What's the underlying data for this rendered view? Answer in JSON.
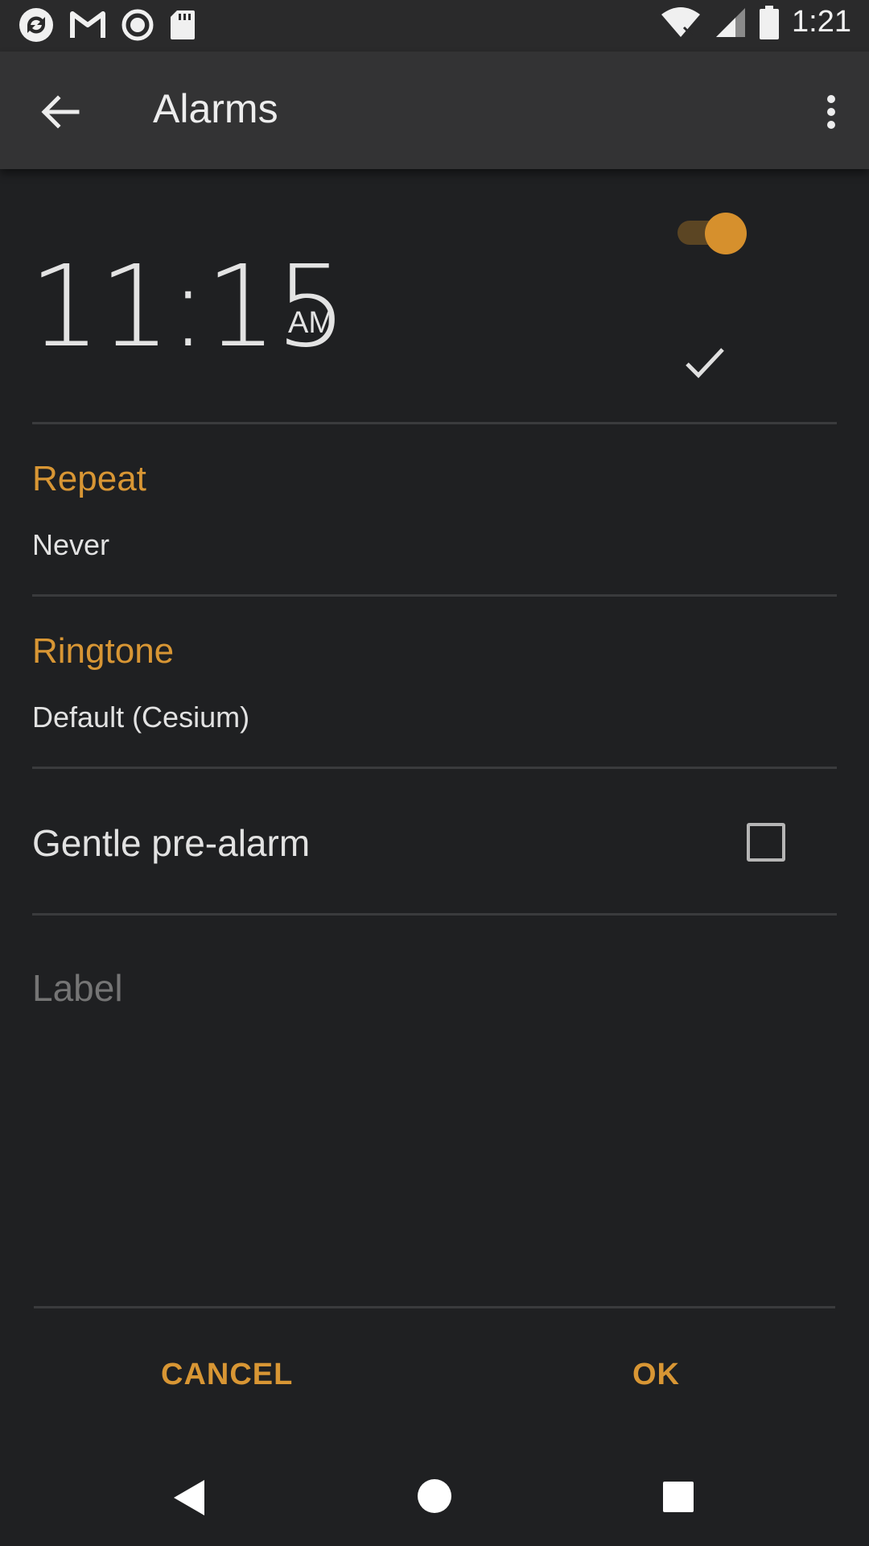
{
  "status_bar": {
    "time": "1:21",
    "left_icons": [
      "sync-icon",
      "gmail-icon",
      "record-icon",
      "sd-card-icon"
    ],
    "right_icons": [
      "wifi-icon",
      "signal-icon",
      "battery-icon"
    ]
  },
  "app_bar": {
    "title": "Alarms",
    "back_icon": "arrow-back-icon",
    "menu_icon": "more-vert-icon"
  },
  "alarm": {
    "time": "11:15",
    "ampm": "AM",
    "enabled": true,
    "accent_color": "#d89634"
  },
  "repeat": {
    "title": "Repeat",
    "value": "Never"
  },
  "ringtone": {
    "title": "Ringtone",
    "value": "Default (Cesium)"
  },
  "pre_alarm": {
    "label": "Gentle pre-alarm",
    "checked": false
  },
  "label_field": {
    "placeholder": "Label",
    "value": ""
  },
  "buttons": {
    "cancel": "CANCEL",
    "ok": "OK"
  },
  "nav_bar": {
    "icons": [
      "back-triangle-icon",
      "home-circle-icon",
      "recents-square-icon"
    ]
  }
}
